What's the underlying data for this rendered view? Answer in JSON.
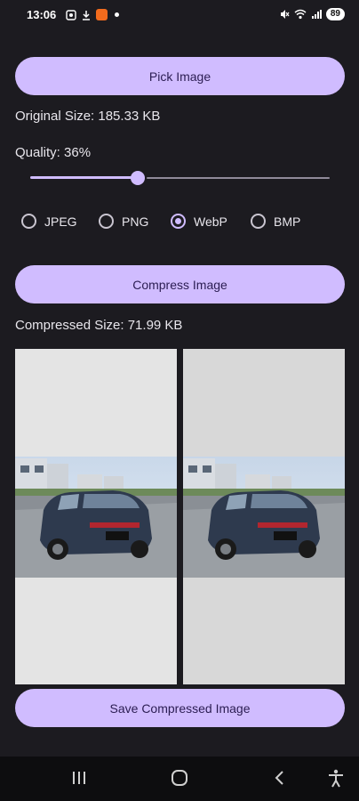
{
  "status_bar": {
    "time": "13:06",
    "battery": "89"
  },
  "buttons": {
    "pick_image": "Pick Image",
    "compress_image": "Compress Image",
    "save_compressed_image": "Save Compressed Image"
  },
  "info": {
    "original_size": "Original Size: 185.33 KB",
    "quality": "Quality: 36%",
    "compressed_size": "Compressed Size: 71.99 KB"
  },
  "slider": {
    "value_fraction": 0.36
  },
  "format_options": [
    {
      "label": "JPEG",
      "selected": false
    },
    {
      "label": "PNG",
      "selected": false
    },
    {
      "label": "WebP",
      "selected": true
    },
    {
      "label": "BMP",
      "selected": false
    }
  ],
  "colors": {
    "accent": "#d0bcff",
    "background": "#1c1b20"
  },
  "nav_icons": [
    "recents-icon",
    "home-icon",
    "back-icon",
    "accessibility-icon"
  ]
}
